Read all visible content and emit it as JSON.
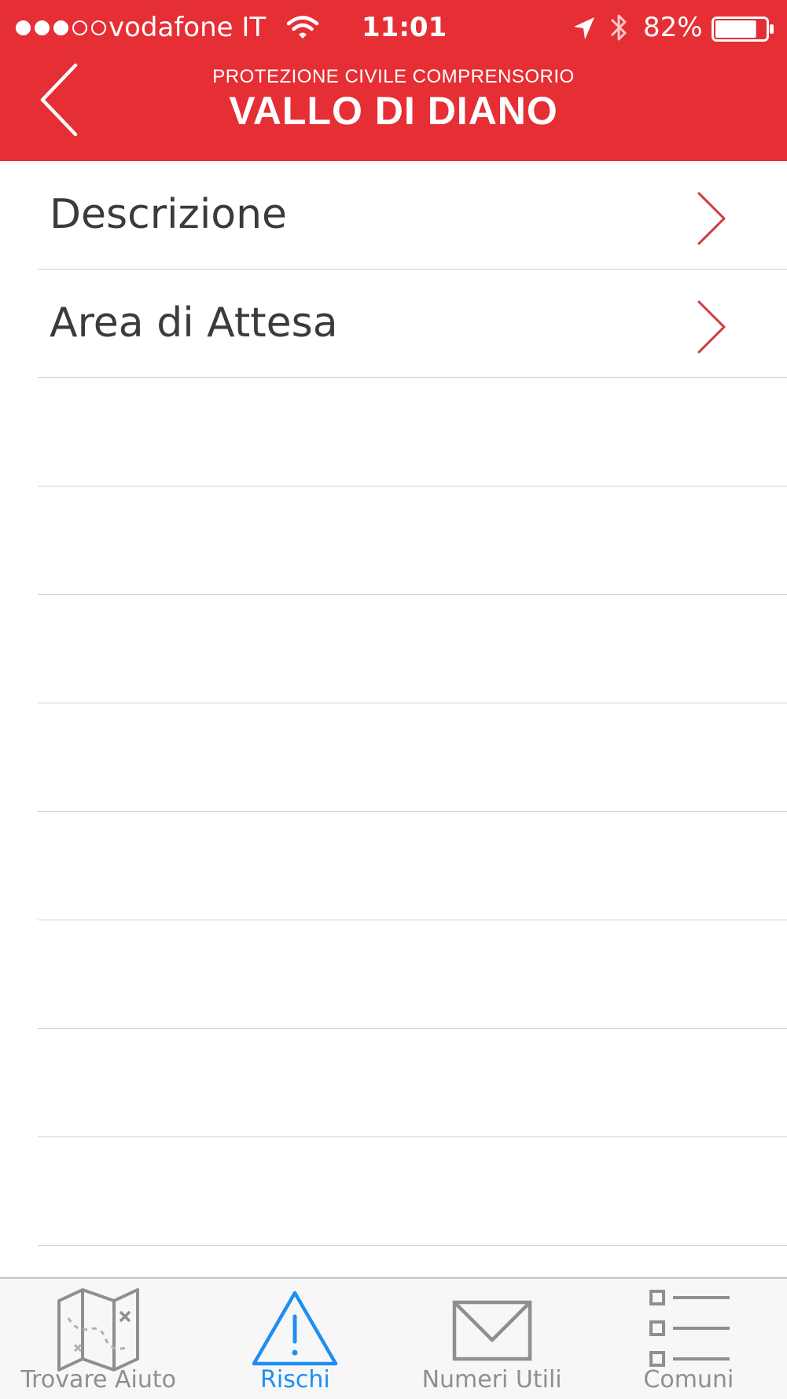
{
  "status_bar": {
    "carrier": "vodafone IT",
    "time": "11:01",
    "battery_percent": "82%",
    "battery_level": 0.82,
    "signal_bars_filled": 3,
    "signal_bars_total": 5
  },
  "header": {
    "subtitle": "PROTEZIONE CIVILE COMPRENSORIO",
    "title": "VALLO DI DIANO",
    "background_color": "#e62e35"
  },
  "list": {
    "items": [
      {
        "label": "Descrizione"
      },
      {
        "label": "Area di Attesa"
      }
    ],
    "chevron_color": "#d0393f"
  },
  "tab_bar": {
    "active_color": "#1f8ef1",
    "inactive_color": "#8e8e93",
    "tabs": [
      {
        "label": "Trovare Aiuto",
        "icon": "map-icon",
        "active": false
      },
      {
        "label": "Rischi",
        "icon": "warning-icon",
        "active": true
      },
      {
        "label": "Numeri Utili",
        "icon": "envelope-icon",
        "active": false
      },
      {
        "label": "Comuni",
        "icon": "list-icon",
        "active": false
      }
    ]
  }
}
